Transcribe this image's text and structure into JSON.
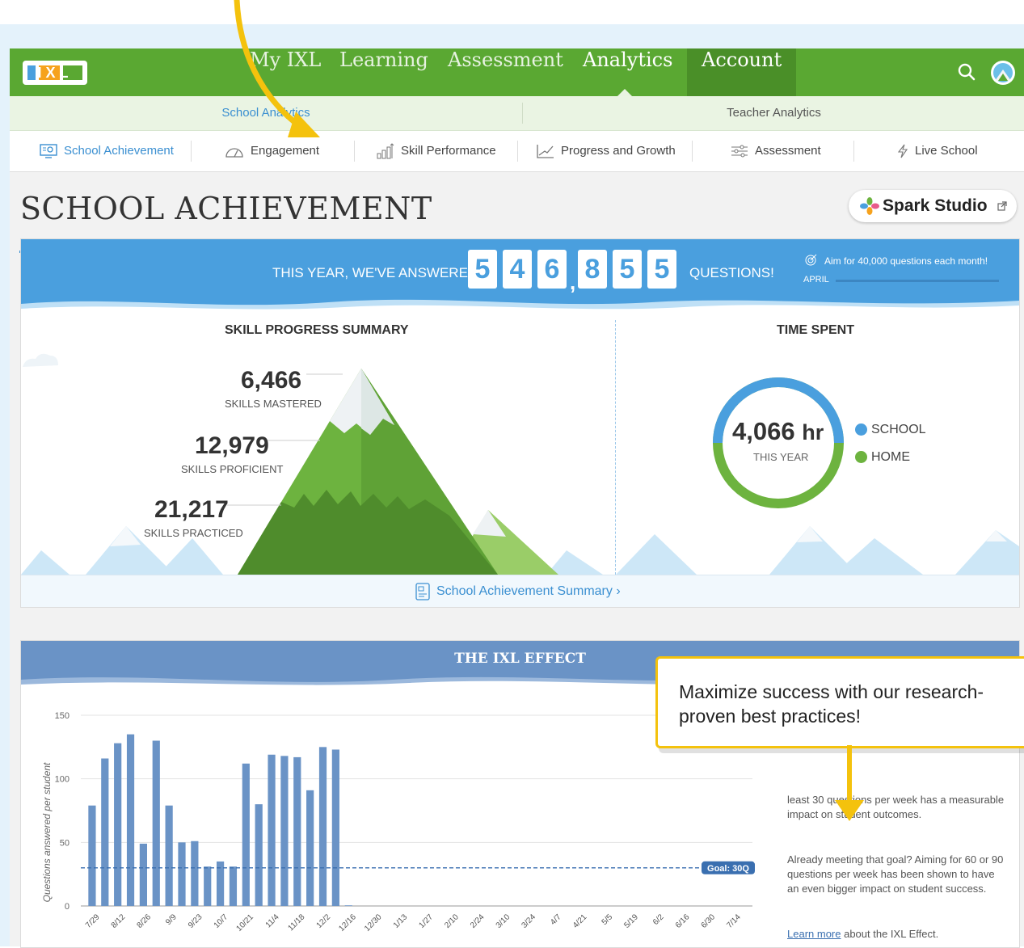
{
  "nav": {
    "logo_text": "IXL",
    "items": [
      "My IXL",
      "Learning",
      "Assessment",
      "Analytics",
      "Account"
    ],
    "active": "Analytics"
  },
  "subnav": {
    "school": "School Analytics",
    "teacher": "Teacher Analytics"
  },
  "tabs": [
    "School Achievement",
    "Engagement",
    "Skill Performance",
    "Progress and Growth",
    "Assessment",
    "Live School"
  ],
  "page": {
    "title": "SCHOOL ACHIEVEMENT",
    "spark_label": "Spark Studio"
  },
  "banner": {
    "prefix": "THIS YEAR, WE'VE ANSWERED",
    "digits": [
      "5",
      "4",
      "6",
      "8",
      "5",
      "5"
    ],
    "suffix": "QUESTIONS!",
    "aim": "Aim for 40,000 questions each month!",
    "month": "APRIL"
  },
  "skills": {
    "heading": "SKILL PROGRESS SUMMARY",
    "mastered_value": "6,466",
    "mastered_label": "SKILLS MASTERED",
    "proficient_value": "12,979",
    "proficient_label": "SKILLS PROFICIENT",
    "practiced_value": "21,217",
    "practiced_label": "SKILLS PRACTICED"
  },
  "time": {
    "heading": "TIME SPENT",
    "value": "4,066",
    "unit": "hr",
    "caption": "THIS YEAR",
    "school_label": "SCHOOL",
    "home_label": "HOME",
    "school_fraction": 0.5,
    "colors": {
      "school": "#4a9fde",
      "home": "#6db33f"
    }
  },
  "summary_link": "School Achievement Summary ›",
  "effect": {
    "title": "THE IXL EFFECT",
    "para1": "least 30 questions per week has a measurable impact on student outcomes.",
    "para2": "Already meeting that goal? Aiming for 60 or 90 questions per week has been shown to have an even bigger impact on student success.",
    "learn_more": "Learn more",
    "learn_more_rest": " about the IXL Effect."
  },
  "callout": {
    "text": "Maximize success with our research-proven best practices!"
  },
  "chart_data": {
    "type": "bar",
    "ylabel": "Questions answered per student",
    "ylim": [
      0,
      150
    ],
    "yticks": [
      0,
      50,
      100,
      150
    ],
    "goal": 30,
    "goal_label": "Goal: 30Q",
    "xticks": [
      "7/29",
      "8/12",
      "8/26",
      "9/9",
      "9/23",
      "10/7",
      "10/21",
      "11/4",
      "11/18",
      "12/2",
      "12/16",
      "12/30",
      "1/13",
      "1/27",
      "2/10",
      "2/24",
      "3/10",
      "3/24",
      "4/7",
      "4/21",
      "5/5",
      "5/19",
      "6/2",
      "6/16",
      "6/30",
      "7/14"
    ],
    "values": [
      79,
      116,
      128,
      135,
      49,
      130,
      79,
      50,
      51,
      31,
      35,
      31,
      112,
      80,
      119,
      118,
      117,
      91,
      125,
      123,
      0.5,
      0,
      0,
      0,
      0,
      0,
      0,
      0,
      0,
      0,
      0,
      0,
      0,
      0,
      0,
      0,
      0,
      0,
      0,
      0,
      0,
      0,
      0,
      0,
      0,
      0,
      0,
      0,
      0,
      0,
      0,
      0
    ],
    "color": "#6a93c6"
  }
}
